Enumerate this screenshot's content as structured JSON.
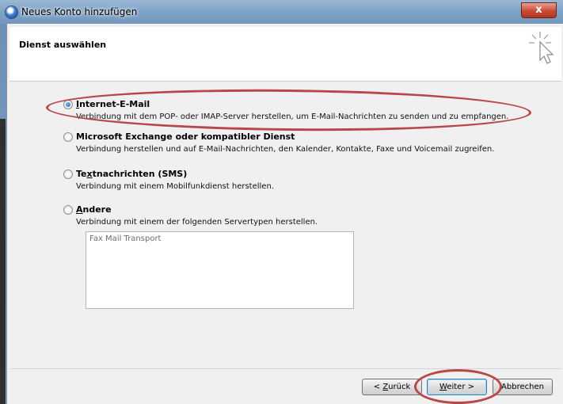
{
  "window": {
    "title": "Neues Konto hinzufügen",
    "close_glyph": "x"
  },
  "header": {
    "title": "Dienst auswählen"
  },
  "options": [
    {
      "label_pre": "",
      "label_ul": "I",
      "label_post": "nternet-E-Mail",
      "description": "Verbindung mit dem POP- oder IMAP-Server herstellen, um E-Mail-Nachrichten zu senden und zu empfangen.",
      "checked": true
    },
    {
      "label_pre": "",
      "label_ul": "",
      "label_post": "Microsoft Exchange oder kompatibler Dienst",
      "description": "Verbindung herstellen und auf E-Mail-Nachrichten, den Kalender, Kontakte, Faxe und Voicemail zugreifen.",
      "checked": false
    },
    {
      "label_pre": "Te",
      "label_ul": "x",
      "label_post": "tnachrichten (SMS)",
      "description": "Verbindung mit einem Mobilfunkdienst herstellen.",
      "checked": false
    },
    {
      "label_pre": "",
      "label_ul": "A",
      "label_post": "ndere",
      "description": "Verbindung mit einem der folgenden Servertypen herstellen.",
      "checked": false
    }
  ],
  "server_types": [
    "Fax Mail Transport"
  ],
  "buttons": {
    "back_pre": "< ",
    "back_ul": "Z",
    "back_post": "urück",
    "next_ul": "W",
    "next_post": "eiter >",
    "cancel": "Abbrechen"
  },
  "colors": {
    "highlight_ring": "#b8474b",
    "accent_blue": "#1c5fb8"
  }
}
